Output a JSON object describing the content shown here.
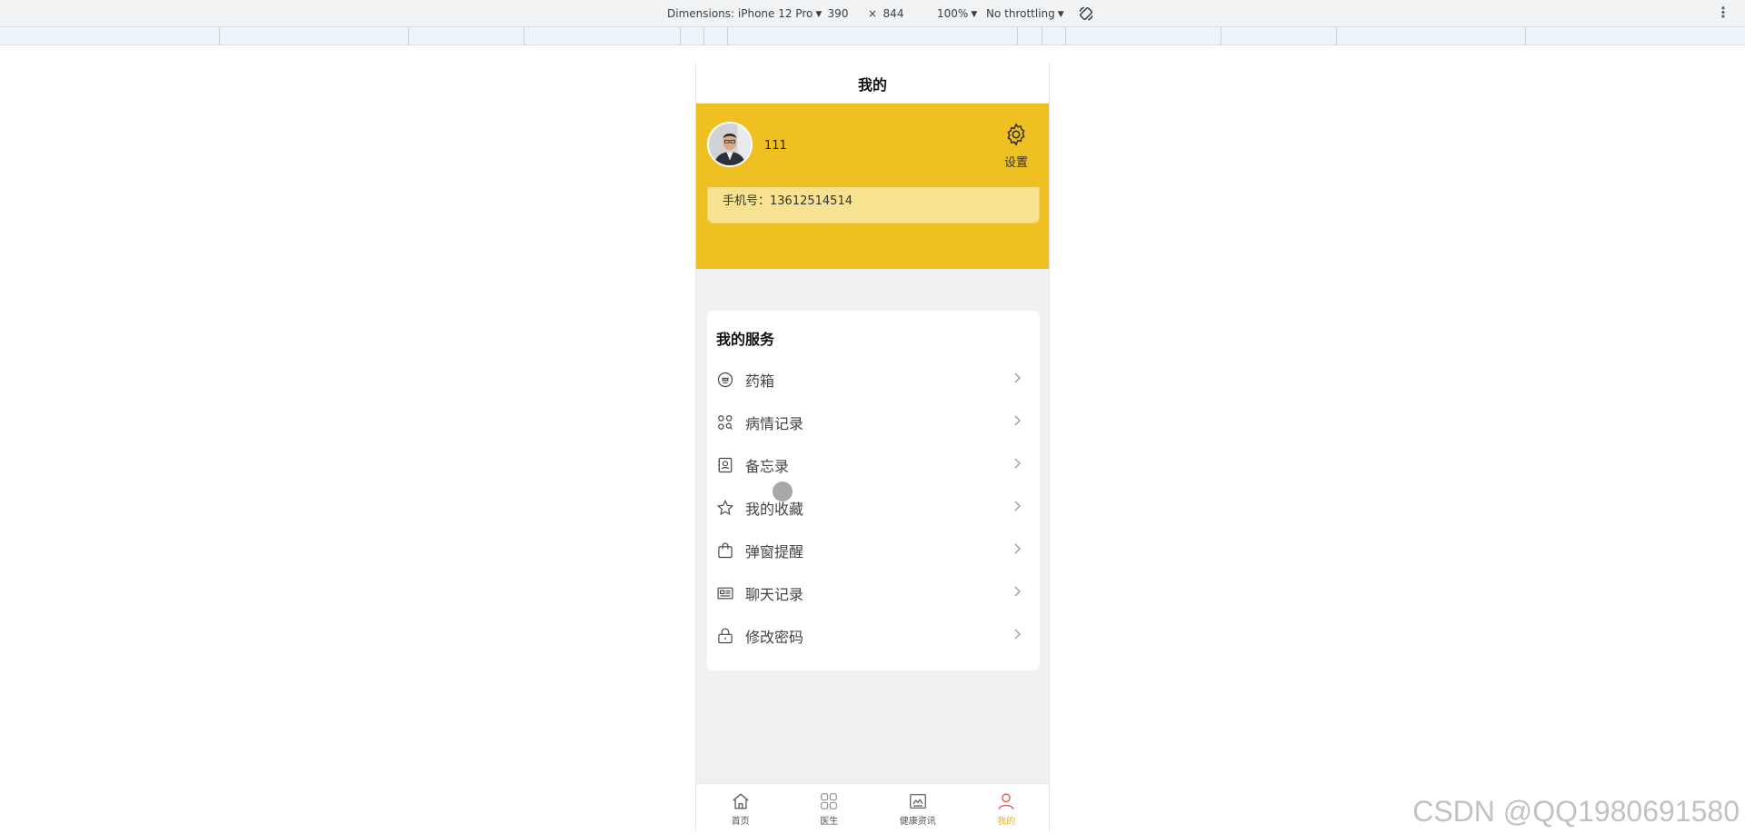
{
  "devtools": {
    "dimensions_label": "Dimensions: iPhone 12 Pro",
    "width_value": "390",
    "times": "×",
    "height_value": "844",
    "zoom": "100%",
    "throttling": "No throttling"
  },
  "page": {
    "title": "我的"
  },
  "profile": {
    "username": "111",
    "settings_label": "设置",
    "phone_text": "手机号：13612514514"
  },
  "services": {
    "title": "我的服务",
    "items": [
      {
        "label": "药箱",
        "icon": "medicine-box-icon"
      },
      {
        "label": "病情记录",
        "icon": "condition-record-icon"
      },
      {
        "label": "备忘录",
        "icon": "memo-icon"
      },
      {
        "label": "我的收藏",
        "icon": "star-icon"
      },
      {
        "label": "弹窗提醒",
        "icon": "bag-icon"
      },
      {
        "label": "聊天记录",
        "icon": "chat-record-icon"
      },
      {
        "label": "修改密码",
        "icon": "lock-icon"
      }
    ]
  },
  "tabbar": {
    "items": [
      {
        "label": "首页",
        "icon": "home-icon",
        "active": false
      },
      {
        "label": "医生",
        "icon": "grid-icon",
        "active": false
      },
      {
        "label": "健康资讯",
        "icon": "news-icon",
        "active": false
      },
      {
        "label": "我的",
        "icon": "user-icon",
        "active": true
      }
    ],
    "active_color": "#e9b11e"
  },
  "theme": {
    "accent": "#efc022",
    "card": "#f7e291"
  },
  "watermark": "CSDN @QQ1980691580"
}
